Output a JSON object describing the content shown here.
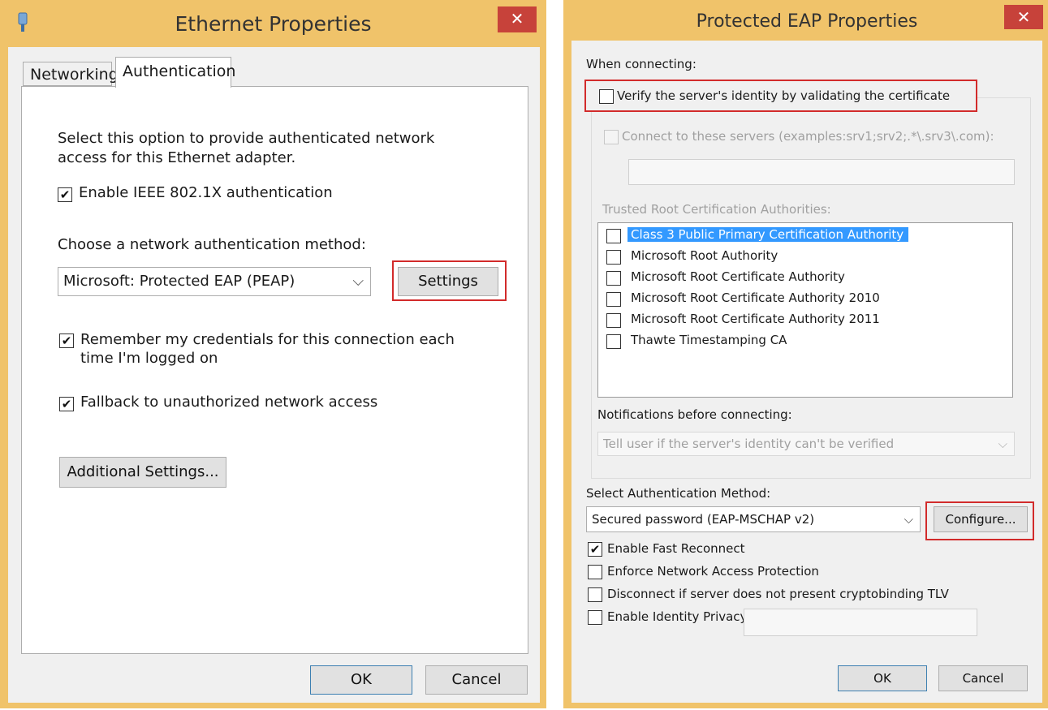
{
  "left_window": {
    "title": "Ethernet Properties",
    "close_glyph": "✕",
    "tabs": [
      {
        "label": "Networking"
      },
      {
        "label": "Authentication"
      }
    ],
    "description": "Select this option to provide authenticated network access for this Ethernet adapter.",
    "enable_8021x": {
      "label": "Enable IEEE 802.1X authentication",
      "checked": true
    },
    "method_label": "Choose a network authentication method:",
    "method_value": "Microsoft: Protected EAP (PEAP)",
    "settings_button": "Settings",
    "remember_credentials": {
      "label_line1": "Remember my credentials for this connection each",
      "label_line2": "time I'm logged on",
      "checked": true
    },
    "fallback": {
      "label": "Fallback to unauthorized network access",
      "checked": true
    },
    "additional_settings_button": "Additional Settings...",
    "ok_button": "OK",
    "cancel_button": "Cancel"
  },
  "right_window": {
    "title": "Protected EAP Properties",
    "close_glyph": "✕",
    "when_connecting": "When connecting:",
    "verify_server": {
      "label": "Verify the server's identity by validating the certificate",
      "checked": false
    },
    "connect_servers": {
      "label": "Connect to these servers (examples:srv1;srv2;.*\\.srv3\\.com):",
      "checked": false
    },
    "trusted_root_label": "Trusted Root Certification Authorities:",
    "ca_list": [
      {
        "label": "Class 3 Public Primary Certification Authority",
        "checked": false,
        "selected": true
      },
      {
        "label": "Microsoft Root Authority",
        "checked": false,
        "selected": false
      },
      {
        "label": "Microsoft Root Certificate Authority",
        "checked": false,
        "selected": false
      },
      {
        "label": "Microsoft Root Certificate Authority 2010",
        "checked": false,
        "selected": false
      },
      {
        "label": "Microsoft Root Certificate Authority 2011",
        "checked": false,
        "selected": false
      },
      {
        "label": "Thawte Timestamping CA",
        "checked": false,
        "selected": false
      }
    ],
    "notifications_label": "Notifications before connecting:",
    "notifications_value": "Tell user if the server's identity can't be verified",
    "auth_method_label": "Select Authentication Method:",
    "auth_method_value": "Secured password (EAP-MSCHAP v2)",
    "configure_button": "Configure...",
    "fast_reconnect": {
      "label": "Enable Fast Reconnect",
      "checked": true
    },
    "nap": {
      "label": "Enforce Network Access Protection",
      "checked": false
    },
    "cryptobinding": {
      "label": "Disconnect if server does not present cryptobinding TLV",
      "checked": false
    },
    "identity_privacy": {
      "label": "Enable Identity Privacy",
      "checked": false
    },
    "ok_button": "OK",
    "cancel_button": "Cancel"
  },
  "colors": {
    "frame": "#f0c36a",
    "close": "#c7423a",
    "highlight_box": "#d22b2b",
    "selection": "#3399ff"
  },
  "glyphs": {
    "check": "✔",
    "dropdown": "⌵"
  }
}
